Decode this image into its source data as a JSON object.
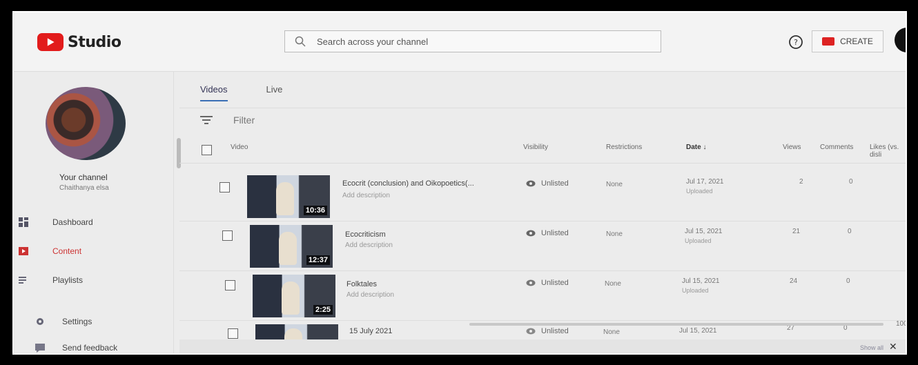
{
  "header": {
    "brand": "Studio",
    "search_placeholder": "Search across your channel",
    "create_label": "CREATE",
    "icons": [
      "youtube-logo-icon",
      "search-icon",
      "help-icon",
      "video-camera-icon"
    ]
  },
  "sidebar": {
    "channel_title": "Your channel",
    "channel_name": "Chaithanya elsa",
    "items": [
      {
        "label": "Dashboard",
        "icon": "dashboard-icon"
      },
      {
        "label": "Content",
        "icon": "content-icon",
        "active": true
      },
      {
        "label": "Playlists",
        "icon": "playlists-icon"
      },
      {
        "label": "Settings",
        "icon": "settings-icon"
      },
      {
        "label": "Send feedback",
        "icon": "feedback-icon"
      }
    ]
  },
  "main": {
    "tabs": [
      {
        "label": "Videos",
        "active": true
      },
      {
        "label": "Live"
      }
    ],
    "filter_label": "Filter",
    "columns": {
      "video": "Video",
      "visibility": "Visibility",
      "restrictions": "Restrictions",
      "date": "Date",
      "views": "Views",
      "comments": "Comments",
      "likes": "Likes (vs. disli"
    },
    "rows": [
      {
        "title": "Ecocrit (conclusion) and Oikopoetics(...",
        "desc": "Add description",
        "duration": "10:36",
        "visibility": "Unlisted",
        "restrictions": "None",
        "date": "Jul 17, 2021",
        "status": "Uploaded",
        "views": "2",
        "comments": "0",
        "likes": ""
      },
      {
        "title": "Ecocriticism",
        "desc": "Add description",
        "duration": "12:37",
        "visibility": "Unlisted",
        "restrictions": "None",
        "date": "Jul 15, 2021",
        "status": "Uploaded",
        "views": "21",
        "comments": "0",
        "likes": ""
      },
      {
        "title": "Folktales",
        "desc": "Add description",
        "duration": "2:25",
        "visibility": "Unlisted",
        "restrictions": "None",
        "date": "Jul 15, 2021",
        "status": "Uploaded",
        "views": "24",
        "comments": "0",
        "likes": ""
      },
      {
        "title": "15 July 2021",
        "desc": "",
        "duration": "",
        "visibility": "Unlisted",
        "restrictions": "None",
        "date": "Jul 15, 2021",
        "status": "",
        "views": "27",
        "comments": "0",
        "likes": "100"
      }
    ],
    "footer": {
      "show_all": "Show all",
      "close": "✕"
    }
  }
}
